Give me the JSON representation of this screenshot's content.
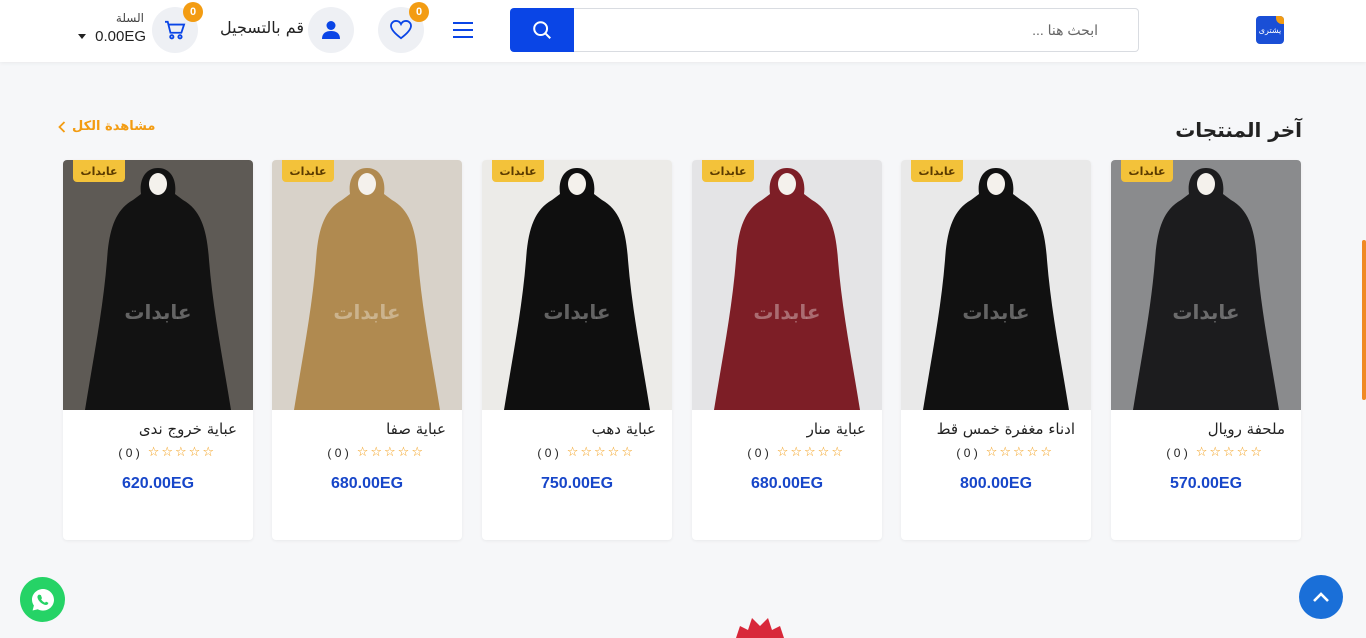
{
  "header": {
    "logo_text": "يشترى",
    "search_placeholder": "ابحث هنا ...",
    "wishlist_count": "0",
    "login_label": "قم بالتسجيل",
    "cart_label": "السلة",
    "cart_total": "0.00EG",
    "cart_count": "0"
  },
  "section": {
    "title": "آخر المنتجات",
    "view_all": "مشاهدة الكل"
  },
  "products": [
    {
      "name": "ملحفة رويال",
      "rating_count": "( 0 )",
      "price": "570.00EG",
      "brand": "عابدات",
      "bg": "#8a8b8d",
      "dress": "#1c1c1e"
    },
    {
      "name": "ادناء مغفرة خمس قط",
      "rating_count": "( 0 )",
      "price": "800.00EG",
      "brand": "عابدات",
      "bg": "#e9e9e9",
      "dress": "#111111"
    },
    {
      "name": "عباية منار",
      "rating_count": "( 0 )",
      "price": "680.00EG",
      "brand": "عابدات",
      "bg": "#e4e4e6",
      "dress": "#7d1e26"
    },
    {
      "name": "عباية دهب",
      "rating_count": "( 0 )",
      "price": "750.00EG",
      "brand": "عابدات",
      "bg": "#ecebe8",
      "dress": "#0f0f0f"
    },
    {
      "name": "عباية صفا",
      "rating_count": "( 0 )",
      "price": "680.00EG",
      "brand": "عابدات",
      "bg": "#d8d2c9",
      "dress": "#b08a50"
    },
    {
      "name": "عباية خروج ندى",
      "rating_count": "( 0 )",
      "price": "620.00EG",
      "brand": "عابدات",
      "bg": "#5e5a55",
      "dress": "#121212"
    }
  ],
  "watermark_text": "عابدات",
  "colors": {
    "primary": "#0a45e6",
    "accent": "#f39c12",
    "price": "#1746c9"
  }
}
